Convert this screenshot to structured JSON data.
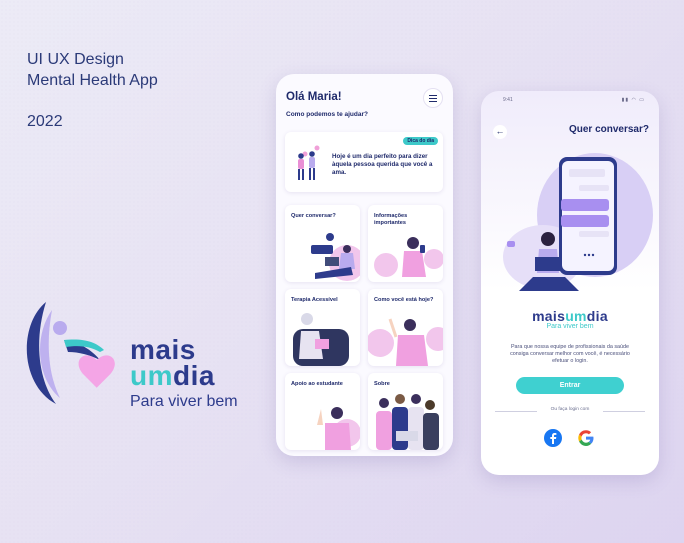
{
  "intro": {
    "line1": "UI UX Design",
    "line2": "Mental Health App",
    "year": "2022"
  },
  "brand": {
    "word1": "mais",
    "word2a": "um",
    "word2b": "dia",
    "tagline": "Para viver bem"
  },
  "colors": {
    "navy": "#2d3b8c",
    "teal": "#3dc9c9",
    "pink": "#f4a5e6",
    "lavender": "#b9abee"
  },
  "home_screen": {
    "greeting": "Olá Maria!",
    "subtitle": "Como podemos te ajudar?",
    "menu_icon": "hamburger-icon",
    "tip": {
      "badge": "Dica do dia",
      "text": "Hoje é um dia perfeito para dizer àquela pessoa querida que você a ama."
    },
    "tiles": [
      {
        "label": "Quer conversar?"
      },
      {
        "label": "Informações importantes"
      },
      {
        "label": "Terapia Acessível"
      },
      {
        "label": "Como você está hoje?"
      },
      {
        "label": "Apoio ao estudante"
      },
      {
        "label": "Sobre"
      }
    ]
  },
  "login_screen": {
    "status_time": "9:41",
    "status_icons": "▮▮ ◠ ▭",
    "back_icon": "arrow-left-icon",
    "title": "Quer conversar?",
    "brand_a": "mais",
    "brand_b": "um",
    "brand_c": "dia",
    "tagline": "Para viver bem",
    "description": "Para que nossa equipe de profissionais da saúde consiga conversar melhor com você, é necessário efetuar o login.",
    "enter_label": "Entrar",
    "or_label": "Ou faça login com",
    "social": [
      "facebook-icon",
      "google-icon"
    ]
  }
}
